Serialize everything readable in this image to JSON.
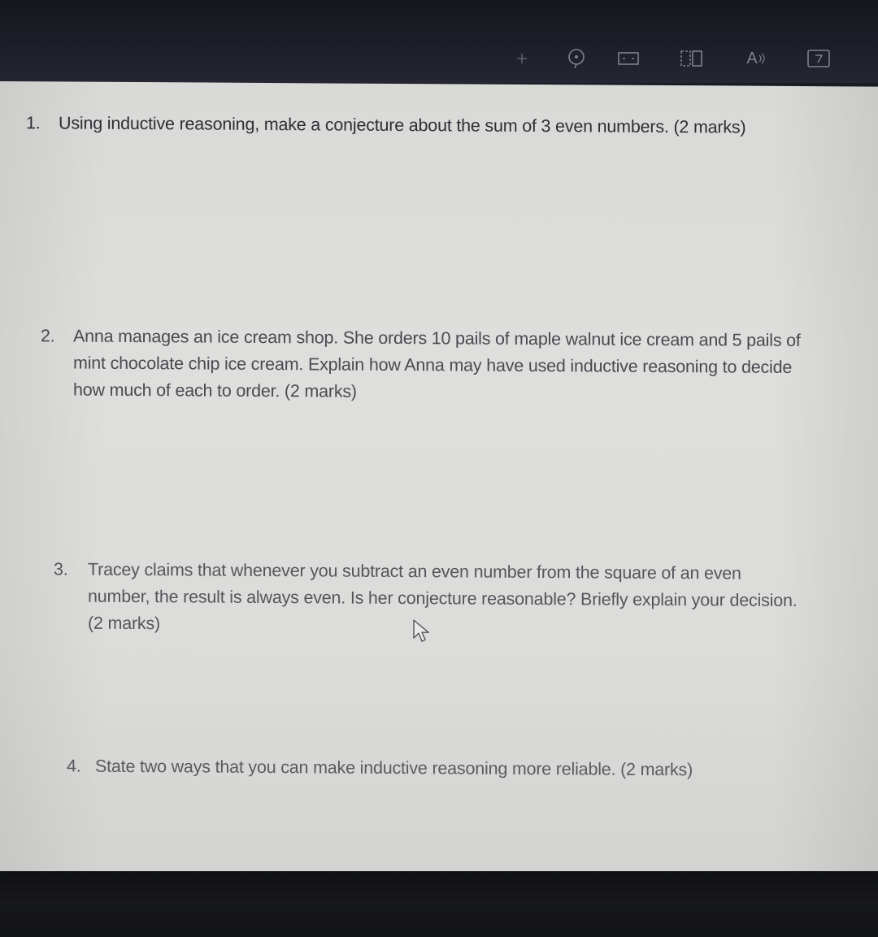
{
  "toolbar": {
    "icons": [
      "add-icon",
      "audio-icon",
      "fit-width-icon",
      "page-view-icon",
      "read-aloud-icon",
      "draw-icon"
    ],
    "read_aloud_label": "A"
  },
  "questions": [
    {
      "number": "1.",
      "text": "Using inductive reasoning, make a conjecture about the sum of 3 even numbers. (2 marks)"
    },
    {
      "number": "2.",
      "text": "Anna manages an ice cream shop. She orders 10 pails of maple walnut ice cream and 5 pails of mint chocolate chip ice cream. Explain how Anna may have used inductive reasoning to decide how much of each to order. (2 marks)"
    },
    {
      "number": "3.",
      "text": "Tracey claims that whenever you subtract an even number from the square of an even number, the result is always even. Is her conjecture reasonable? Briefly explain your decision. (2 marks)"
    },
    {
      "number": "4.",
      "text": "State two ways that you can make inductive reasoning more reliable. (2 marks)"
    }
  ],
  "colors": {
    "page": "#dcdcda",
    "toolbar": "#1d2029",
    "text": "#3c3d44"
  }
}
